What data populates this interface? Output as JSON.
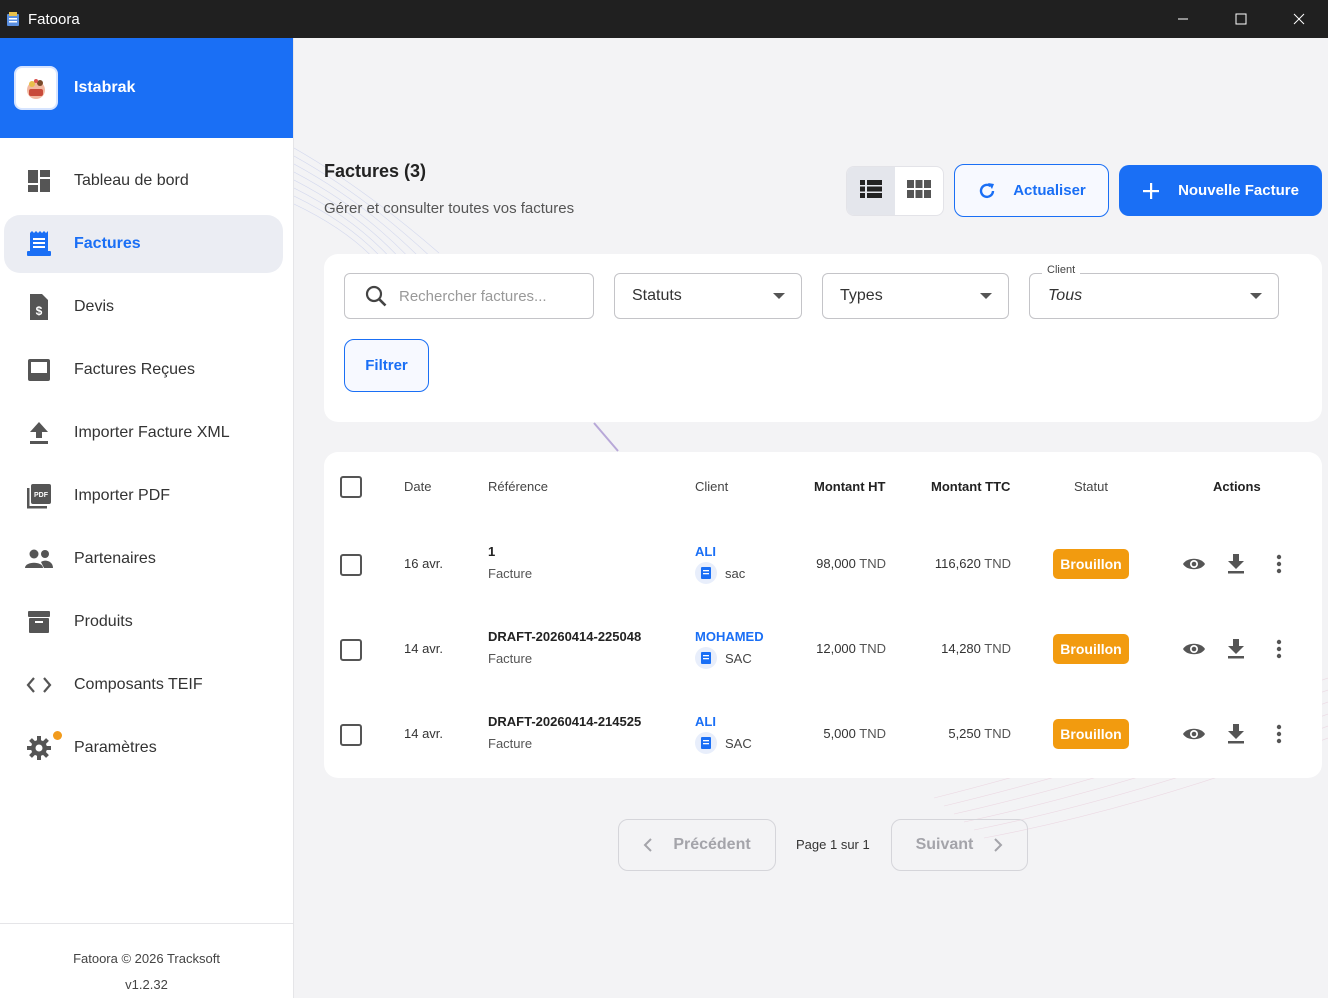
{
  "window": {
    "title": "Fatoora"
  },
  "brand": {
    "name": "Istabrak"
  },
  "sidebar": {
    "items": [
      {
        "label": "Tableau de bord",
        "icon": "dashboard-icon"
      },
      {
        "label": "Factures",
        "icon": "receipt-icon",
        "active": true
      },
      {
        "label": "Devis",
        "icon": "quote-document-icon"
      },
      {
        "label": "Factures Reçues",
        "icon": "inbox-icon"
      },
      {
        "label": "Importer Facture XML",
        "icon": "upload-icon"
      },
      {
        "label": "Importer PDF",
        "icon": "pdf-icon"
      },
      {
        "label": "Partenaires",
        "icon": "people-icon"
      },
      {
        "label": "Produits",
        "icon": "archive-box-icon"
      },
      {
        "label": "Composants TEIF",
        "icon": "code-icon"
      },
      {
        "label": "Paramètres",
        "icon": "gear-icon"
      }
    ],
    "footer": {
      "copyright": "Fatoora © 2026 Tracksoft",
      "version": "v1.2.32"
    }
  },
  "header": {
    "title": "Factures (3)",
    "subtitle": "Gérer et consulter toutes vos factures",
    "refresh_label": "Actualiser",
    "new_label": "Nouvelle Facture"
  },
  "filters": {
    "search_placeholder": "Rechercher factures...",
    "status_label": "Statuts",
    "types_label": "Types",
    "client_legend": "Client",
    "client_value": "Tous",
    "filter_label": "Filtrer"
  },
  "table": {
    "columns": [
      "Date",
      "Référence",
      "Client",
      "Montant HT",
      "Montant TTC",
      "Statut",
      "Actions"
    ],
    "rows": [
      {
        "date": "16 avr.",
        "reference": "1",
        "type": "Facture",
        "client": "ALI",
        "client_sub": "sac",
        "ht": "98,000",
        "ttc": "116,620",
        "currency": "TND",
        "status": "Brouillon"
      },
      {
        "date": "14 avr.",
        "reference": "DRAFT-20260414-225048",
        "type": "Facture",
        "client": "MOHAMED",
        "client_sub": "SAC",
        "ht": "12,000",
        "ttc": "14,280",
        "currency": "TND",
        "status": "Brouillon"
      },
      {
        "date": "14 avr.",
        "reference": "DRAFT-20260414-214525",
        "type": "Facture",
        "client": "ALI",
        "client_sub": "SAC",
        "ht": "5,000",
        "ttc": "5,250",
        "currency": "TND",
        "status": "Brouillon"
      }
    ]
  },
  "pagination": {
    "prev_label": "Précédent",
    "page_text": "Page 1 sur 1",
    "next_label": "Suivant"
  },
  "colors": {
    "primary": "#1a6ff5",
    "status_draft": "#f29b0f",
    "active_bg": "#ebedf3"
  }
}
